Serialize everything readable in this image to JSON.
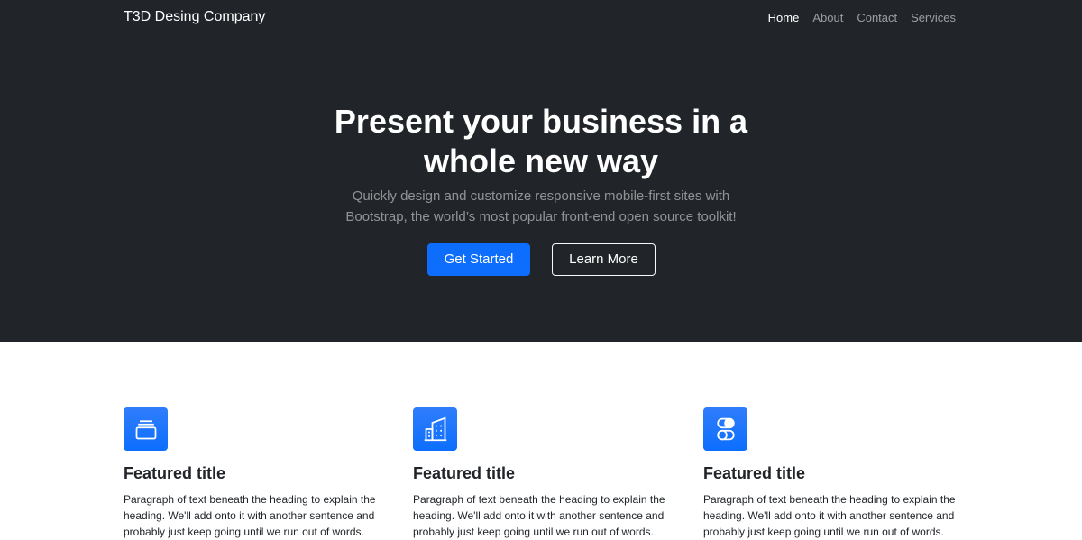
{
  "navbar": {
    "brand": "T3D Desing Company",
    "links": [
      {
        "label": "Home",
        "active": true
      },
      {
        "label": "About",
        "active": false
      },
      {
        "label": "Contact",
        "active": false
      },
      {
        "label": "Services",
        "active": false
      }
    ]
  },
  "hero": {
    "title": "Present your business in a whole new way",
    "lead": "Quickly design and customize responsive mobile-first sites with Bootstrap, the world’s most popular front-end open source toolkit!",
    "primary_button": "Get Started",
    "secondary_button": "Learn More"
  },
  "features": [
    {
      "icon": "collection-icon",
      "title": "Featured title",
      "text": "Paragraph of text beneath the heading to explain the heading. We'll add onto it with another sentence and probably just keep going until we run out of words."
    },
    {
      "icon": "building-icon",
      "title": "Featured title",
      "text": "Paragraph of text beneath the heading to explain the heading. We'll add onto it with another sentence and probably just keep going until we run out of words."
    },
    {
      "icon": "toggles-icon",
      "title": "Featured title",
      "text": "Paragraph of text beneath the heading to explain the heading. We'll add onto it with another sentence and probably just keep going until we run out of words."
    }
  ],
  "colors": {
    "dark": "#212529",
    "primary": "#0d6efd",
    "white": "#ffffff"
  }
}
